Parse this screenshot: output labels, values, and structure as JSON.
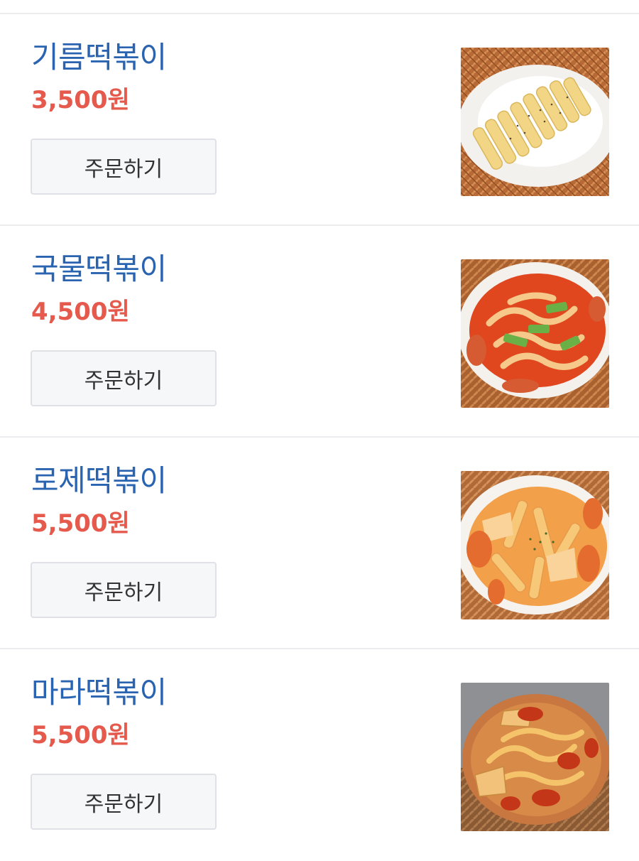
{
  "menu": {
    "items": [
      {
        "name": "기름떡볶이",
        "price": "3,500원",
        "order_label": "주문하기",
        "image": "gireum-tteokbokki-photo"
      },
      {
        "name": "국물떡볶이",
        "price": "4,500원",
        "order_label": "주문하기",
        "image": "gungmul-tteokbokki-photo"
      },
      {
        "name": "로제떡볶이",
        "price": "5,500원",
        "order_label": "주문하기",
        "image": "rose-tteokbokki-photo"
      },
      {
        "name": "마라떡볶이",
        "price": "5,500원",
        "order_label": "주문하기",
        "image": "mala-tteokbokki-photo"
      }
    ]
  },
  "colors": {
    "name_blue": "#2a63b0",
    "price_red": "#e55a4c",
    "button_bg": "#f6f7f9",
    "button_border": "#dfe1e6",
    "divider": "#ececef"
  }
}
